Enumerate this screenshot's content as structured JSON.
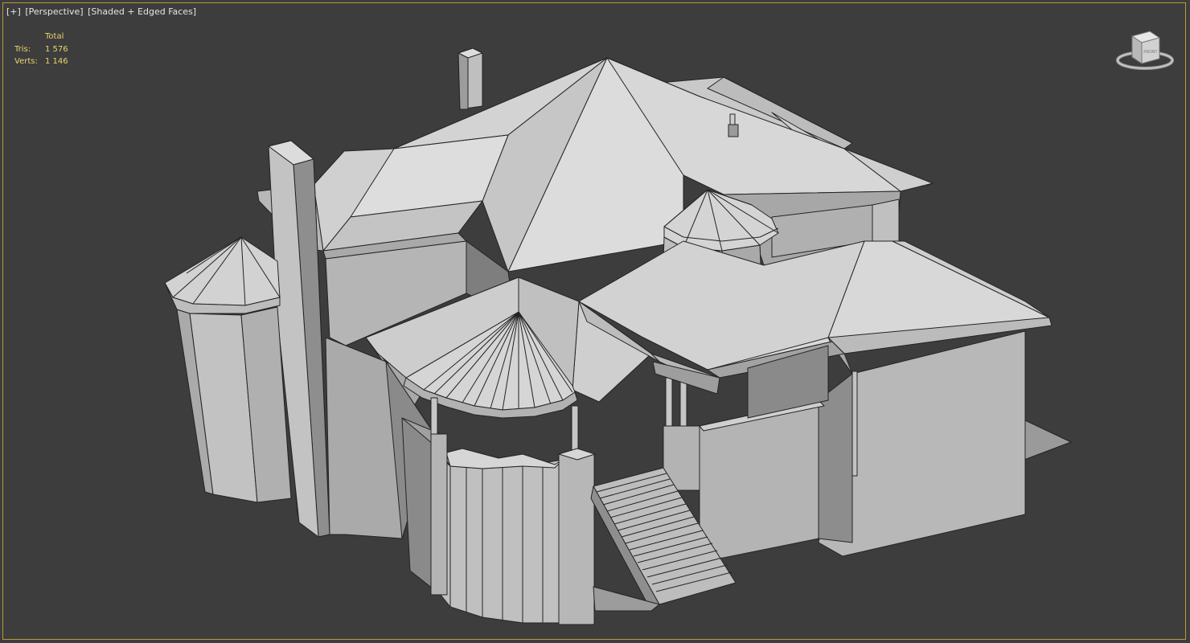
{
  "viewport": {
    "menu_plus": "[+]",
    "view_label": "[Perspective]",
    "shading_label": "[Shaded + Edged Faces]"
  },
  "stats": {
    "header": "Total",
    "tris_label": "Tris:",
    "tris_value": "1 576",
    "verts_label": "Verts:",
    "verts_value": "1 146"
  },
  "viewcube": {
    "face_label": "FRONT",
    "icon": "viewcube-icon"
  },
  "colors": {
    "background": "#3d3d3d",
    "frame": "#b59a3a",
    "stats_text": "#e8d56b",
    "mesh_light": "#d9d9d9",
    "mesh_mid": "#bdbdbd",
    "mesh_dark": "#8f8f8f",
    "edge": "#222222"
  }
}
